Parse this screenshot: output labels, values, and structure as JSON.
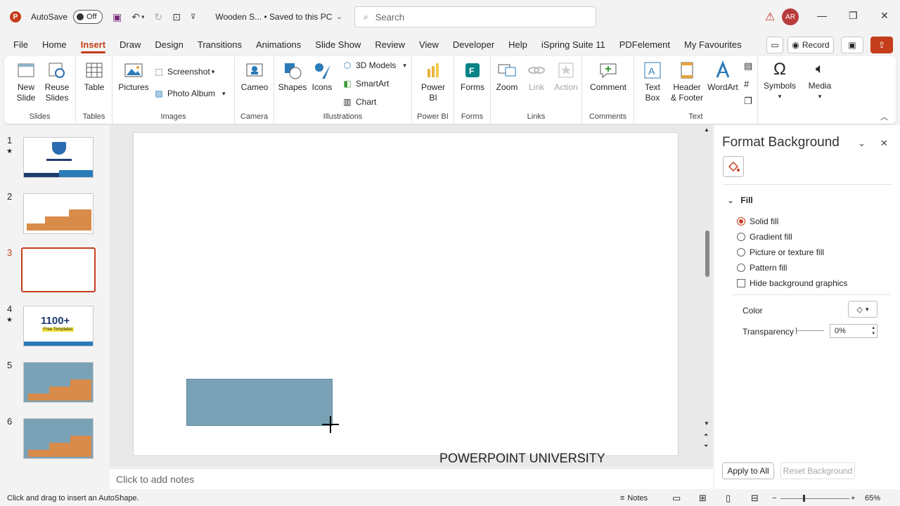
{
  "titlebar": {
    "autosave_label": "AutoSave",
    "autosave_state": "Off",
    "doc_title": "Wooden S...  •  Saved to this PC",
    "search_placeholder": "Search",
    "avatar_initials": "AR"
  },
  "menu": {
    "tabs": [
      "File",
      "Home",
      "Insert",
      "Draw",
      "Design",
      "Transitions",
      "Animations",
      "Slide Show",
      "Review",
      "View",
      "Developer",
      "Help",
      "iSpring Suite 11",
      "PDFelement",
      "My Favourites"
    ],
    "active": "Insert",
    "record_label": "Record"
  },
  "ribbon": {
    "slides": {
      "label": "Slides",
      "new_slide": "New Slide",
      "reuse_slides": "Reuse Slides"
    },
    "tables": {
      "label": "Tables",
      "table": "Table"
    },
    "images": {
      "label": "Images",
      "pictures": "Pictures",
      "screenshot": "Screenshot",
      "photo_album": "Photo Album"
    },
    "camera": {
      "label": "Camera",
      "cameo": "Cameo"
    },
    "illustrations": {
      "label": "Illustrations",
      "shapes": "Shapes",
      "icons": "Icons",
      "models_3d": "3D Models",
      "smartart": "SmartArt",
      "chart": "Chart"
    },
    "powerbi": {
      "label": "Power BI",
      "power_bi": "Power BI"
    },
    "forms": {
      "label": "Forms",
      "forms": "Forms"
    },
    "links": {
      "label": "Links",
      "zoom": "Zoom",
      "link": "Link",
      "action": "Action"
    },
    "comments": {
      "label": "Comments",
      "comment": "Comment"
    },
    "text": {
      "label": "Text",
      "text_box": "Text Box",
      "header_footer": "Header & Footer",
      "wordart": "WordArt"
    },
    "symbols": {
      "symbols": "Symbols"
    },
    "media": {
      "media": "Media"
    }
  },
  "slides_panel": {
    "items": [
      {
        "num": "1",
        "starred": true
      },
      {
        "num": "2",
        "starred": false
      },
      {
        "num": "3",
        "starred": false,
        "selected": true
      },
      {
        "num": "4",
        "starred": true,
        "big_text": "1100+",
        "sub_text": "Free Templates"
      },
      {
        "num": "5",
        "starred": false
      },
      {
        "num": "6",
        "starred": false
      }
    ]
  },
  "slide": {
    "footer_text": "POWERPOINT UNIVERSITY",
    "shape_color": "#7aa2b6"
  },
  "notes": {
    "placeholder": "Click to add notes"
  },
  "format_pane": {
    "title": "Format Background",
    "section": "Fill",
    "options": [
      "Solid fill",
      "Gradient fill",
      "Picture or texture fill",
      "Pattern fill"
    ],
    "selected_option": "Solid fill",
    "hide_bg": "Hide background graphics",
    "color_label": "Color",
    "transparency_label": "Transparency",
    "transparency_value": "0%",
    "apply_all": "Apply to All",
    "reset": "Reset Background"
  },
  "status": {
    "message": "Click and drag to insert an AutoShape.",
    "notes": "Notes",
    "zoom": "65%"
  },
  "colors": {
    "accent": "#c43e1c",
    "shape": "#7aa2b6"
  }
}
